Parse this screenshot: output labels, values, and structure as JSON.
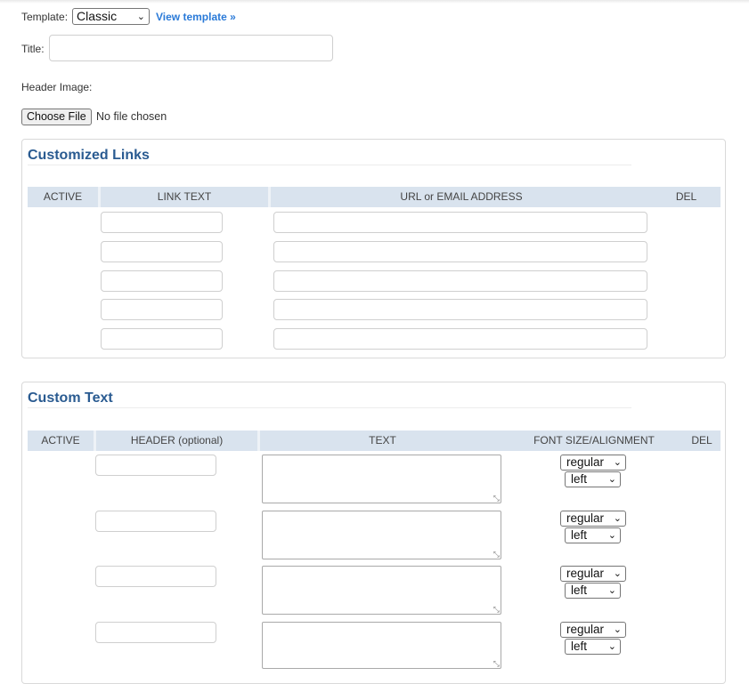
{
  "form": {
    "template_label": "Template:",
    "template_selected": "Classic",
    "view_template_link": "View template »",
    "title_label": "Title:",
    "title_value": "",
    "header_image_label": "Header Image:",
    "choose_file_button": "Choose File",
    "file_status": "No file chosen"
  },
  "links_section": {
    "title": "Customized Links",
    "columns": [
      "ACTIVE",
      "LINK TEXT",
      "URL or EMAIL ADDRESS",
      "DEL"
    ],
    "rows": [
      {
        "link_text": "",
        "url": ""
      },
      {
        "link_text": "",
        "url": ""
      },
      {
        "link_text": "",
        "url": ""
      },
      {
        "link_text": "",
        "url": ""
      },
      {
        "link_text": "",
        "url": ""
      }
    ]
  },
  "text_section": {
    "title": "Custom Text",
    "columns": [
      "ACTIVE",
      "HEADER (optional)",
      "TEXT",
      "FONT SIZE/ALIGNMENT",
      "DEL"
    ],
    "rows": [
      {
        "header": "",
        "text": "",
        "font_size": "regular",
        "alignment": "left"
      },
      {
        "header": "",
        "text": "",
        "font_size": "regular",
        "alignment": "left"
      },
      {
        "header": "",
        "text": "",
        "font_size": "regular",
        "alignment": "left"
      },
      {
        "header": "",
        "text": "",
        "font_size": "regular",
        "alignment": "left"
      }
    ]
  },
  "icons": {
    "dropdown": "chevron-down-icon",
    "resize": "resize-grip-icon"
  },
  "colors": {
    "link": "#2a7ad8",
    "section_title": "#2a5b91",
    "table_header_bg": "#d9e3ee"
  }
}
